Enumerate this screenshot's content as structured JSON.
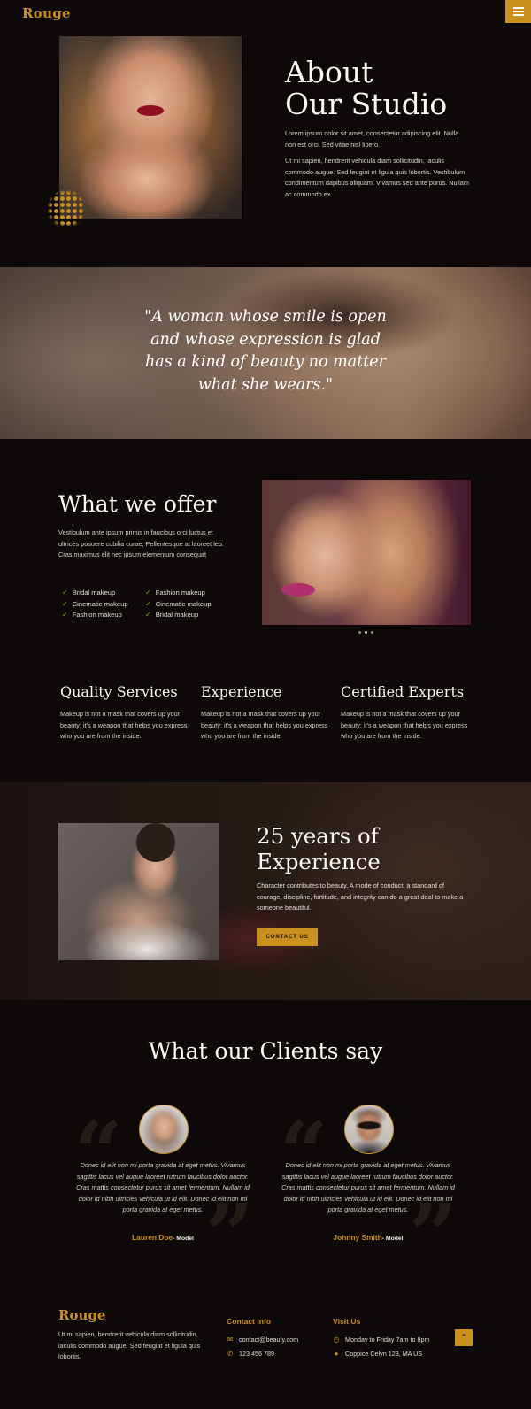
{
  "header": {
    "logo": "Rouge",
    "menu_icon": "hamburger-icon"
  },
  "about": {
    "title_line1": "About",
    "title_line2": "Our Studio",
    "paragraph1": "Lorem ipsum dolor sit amet, consectetur adipiscing elit. Nulla non est orci. Sed vitae nisl libero.",
    "paragraph2": "Ut mi sapien, hendrerit vehicula diam sollicitudin, iaculis commodo augue. Sed feugiat et ligula quis lobortis. Vestibulum condimentum dapibus aliquam. Vivamus sed ante purus. Nullam ac commodo ex."
  },
  "quote": {
    "text": "\"A woman whose smile is open and whose expression is glad has a kind of beauty no matter what she wears.\""
  },
  "offer": {
    "title": "What we offer",
    "description": "Vestibulum ante ipsum primis in faucibus orci luctus et ultrices posuere cubilia curae; Pellentesque at laoreet leo. Cras maximus elit nec ipsum elementum consequat",
    "list_left": [
      "Bridal makeup",
      "Cinematic makeup",
      "Fashion makeup"
    ],
    "list_right": [
      "Fashion makeup",
      "Cinematic makeup",
      "Bridal makeup"
    ],
    "carousel_dots": 3,
    "carousel_active": 2
  },
  "features": [
    {
      "title": "Quality Services",
      "text": "Makeup is not a mask that covers up your beauty; it's a weapon that helps you express who you are from the inside."
    },
    {
      "title": "Experience",
      "text": "Makeup is not a mask that covers up your beauty; it's a weapon that helps you express who you are from the inside."
    },
    {
      "title": "Certified Experts",
      "text": "Makeup is not a mask that covers up your beauty; it's a weapon that helps you express who you are from the inside."
    }
  ],
  "experience": {
    "title_line1": "25 years of",
    "title_line2": "Experience",
    "description": "Character contributes to beauty.  A mode of conduct, a standard of courage, discipline, fortitude, and integrity can do a great deal to make a someone beautiful.",
    "button": "CONTACT US"
  },
  "clients": {
    "title": "What our Clients say",
    "testimonials": [
      {
        "text": "Donec id elit non mi porta gravida at eget metus. Vivamus sagittis lacus vel augue laoreet rutrum faucibus dolor auctor. Cras mattis consectetur purus sit amet fermentum. Nullam id dolor id nibh ultricies vehicula ut id elit. Donec id elit non mi porta gravida at eget metus.",
        "name": "Lauren Doe",
        "role": "- Model"
      },
      {
        "text": "Donec id elit non mi porta gravida at eget metus. Vivamus sagittis lacus vel augue laoreet rutrum faucibus dolor auctor. Cras mattis consectetur purus sit amet fermentum. Nullam id dolor id nibh ultricies vehicula ut id elit. Donec id elit non mi porta gravida at eget metus.",
        "name": "Johnny Smith",
        "role": "- Model"
      }
    ]
  },
  "footer": {
    "logo": "Rouge",
    "description": "Ut mi sapien, hendrerit vehicula diam sollicitudin, iaculis commodo augue. Sed feugiat et ligula quis lobortis.",
    "contact_heading": "Contact Info",
    "email": "contact@beauty.com",
    "phone": "123 456 789",
    "visit_heading": "Visit Us",
    "hours": "Monday to Friday 7am to 8pm",
    "address": "Coppice Celyn 123, MA US"
  },
  "colors": {
    "accent": "#c9901d",
    "background": "#0c0908"
  }
}
